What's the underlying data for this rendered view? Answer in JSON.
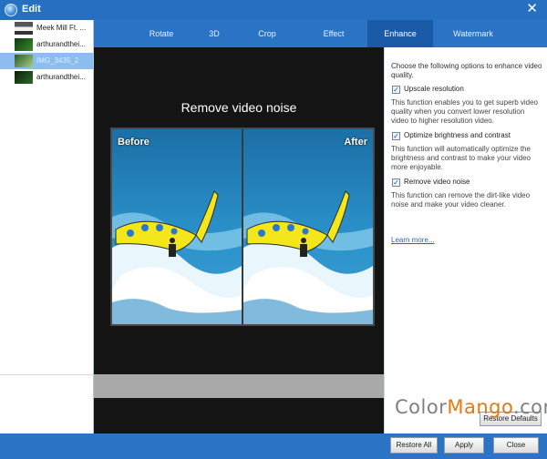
{
  "window": {
    "title": "Edit",
    "close_symbol": "✕"
  },
  "colors": {
    "titlebar": "#2570c0",
    "tab_bar": "#2b73c4",
    "active_tab": "#1a5aa6",
    "selected_item": "#8dbdf0",
    "link": "#2a64c2",
    "watermark_gray": "#7f7f7f",
    "watermark_orange": "#e07a14"
  },
  "sidebar": {
    "items": [
      {
        "label": "Meek Mill Ft. ...",
        "selected": false
      },
      {
        "label": "arthurandthei...",
        "selected": false
      },
      {
        "label": "IMG_3435_2",
        "selected": true
      },
      {
        "label": "arthurandthei...",
        "selected": false
      }
    ]
  },
  "tabs": [
    {
      "label": "Rotate",
      "active": false
    },
    {
      "label": "3D",
      "active": false
    },
    {
      "label": "Crop",
      "active": false
    },
    {
      "label": "Effect",
      "active": false
    },
    {
      "label": "Enhance",
      "active": true
    },
    {
      "label": "Watermark",
      "active": false
    }
  ],
  "preview": {
    "heading": "Remove video noise",
    "before_label": "Before",
    "after_label": "After"
  },
  "enhance": {
    "intro": "Choose the following options to enhance video quality.",
    "options": [
      {
        "label": "Upscale resolution",
        "checked": true,
        "description": "This function enables you to get superb video quality when you convert lower resolution video to higher resolution video."
      },
      {
        "label": "Optimize brightness and contrast",
        "checked": true,
        "description": "This function will automatically optimize the brightness and contrast to make your video more enjoyable."
      },
      {
        "label": "Remove video noise",
        "checked": true,
        "description": "This function can remove the dirt-like video noise and make your video cleaner."
      }
    ],
    "learn_more": "Learn more...",
    "restore_defaults": "Restore Defaults"
  },
  "watermark": {
    "part1": "Color",
    "part2": "Mango",
    "part3": ".com"
  },
  "footer": {
    "restore_all": "Restore All",
    "apply": "Apply",
    "close": "Close"
  }
}
